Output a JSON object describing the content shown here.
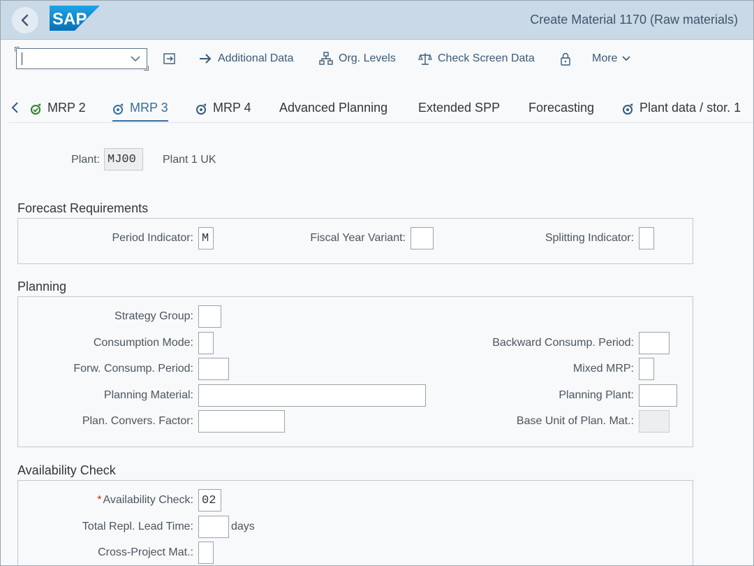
{
  "header": {
    "logo_text": "SAP",
    "title": "Create Material 1170 (Raw materials)"
  },
  "toolbar": {
    "command_value": "",
    "buttons": {
      "additional_data": "Additional Data",
      "org_levels": "Org. Levels",
      "check_screen_data": "Check Screen Data",
      "more": "More"
    }
  },
  "tabs": [
    "MRP 2",
    "MRP 3",
    "MRP 4",
    "Advanced Planning",
    "Extended SPP",
    "Forecasting",
    "Plant data / stor. 1"
  ],
  "active_tab": "MRP 3",
  "plant": {
    "label": "Plant:",
    "value": "MJ00",
    "name": "Plant 1 UK"
  },
  "forecast": {
    "title": "Forecast Requirements",
    "period_indicator_label": "Period Indicator:",
    "period_indicator_value": "M",
    "fiscal_year_variant_label": "Fiscal Year Variant:",
    "fiscal_year_variant_value": "",
    "splitting_indicator_label": "Splitting Indicator:",
    "splitting_indicator_value": ""
  },
  "planning": {
    "title": "Planning",
    "strategy_group_label": "Strategy Group:",
    "consumption_mode_label": "Consumption Mode:",
    "forw_consump_period_label": "Forw. Consump. Period:",
    "planning_material_label": "Planning Material:",
    "plan_convers_factor_label": "Plan. Convers. Factor:",
    "backward_consump_period_label": "Backward Consump. Period:",
    "mixed_mrp_label": "Mixed MRP:",
    "planning_plant_label": "Planning Plant:",
    "base_unit_plan_mat_label": "Base Unit of Plan. Mat.:"
  },
  "availability": {
    "title": "Availability Check",
    "required_marker": "*",
    "availability_check_label": "Availability Check:",
    "availability_check_value": "02",
    "total_repl_lead_time_label": "Total Repl. Lead Time:",
    "total_repl_lead_time_unit": "days",
    "cross_project_mat_label": "Cross-Project Mat.:"
  },
  "colors": {
    "header_bg": "#c9d9e8",
    "accent": "#3a6d9c",
    "required": "#d0271d",
    "sap_blue": "#1b8fd8"
  },
  "icons": [
    "back-arrow-icon",
    "dropdown-chevron-icon",
    "export-icon",
    "arrow-right-icon",
    "org-tree-icon",
    "balance-scale-icon",
    "lock-icon",
    "chevron-down-icon",
    "tab-scroll-left-icon",
    "status-check-icon",
    "in-process-icon"
  ]
}
